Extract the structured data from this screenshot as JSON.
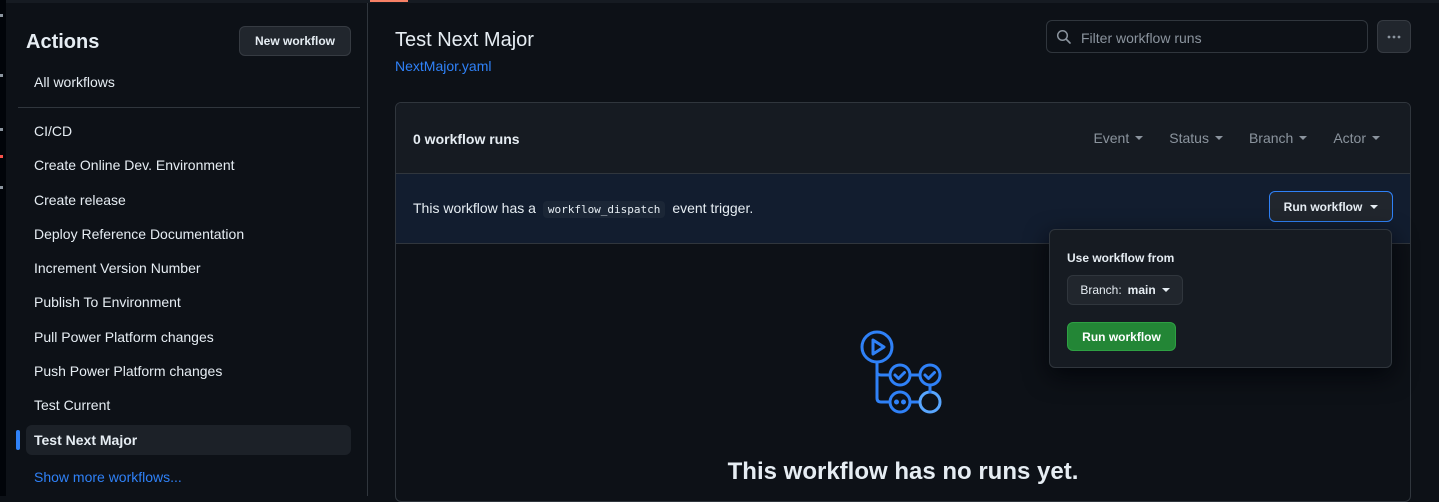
{
  "sidebar": {
    "title": "Actions",
    "new_workflow_label": "New workflow",
    "all_workflows_label": "All workflows",
    "items": [
      {
        "label": "CI/CD"
      },
      {
        "label": "Create Online Dev. Environment"
      },
      {
        "label": "Create release"
      },
      {
        "label": "Deploy Reference Documentation"
      },
      {
        "label": "Increment Version Number"
      },
      {
        "label": "Publish To Environment"
      },
      {
        "label": "Pull Power Platform changes"
      },
      {
        "label": "Push Power Platform changes"
      },
      {
        "label": "Test Current"
      },
      {
        "label": "Test Next Major",
        "active": true
      }
    ],
    "show_more_label": "Show more workflows..."
  },
  "header": {
    "title": "Test Next Major",
    "file": "NextMajor.yaml",
    "filter_placeholder": "Filter workflow runs"
  },
  "runs": {
    "count_label": "0 workflow runs",
    "filters": [
      {
        "label": "Event"
      },
      {
        "label": "Status"
      },
      {
        "label": "Branch"
      },
      {
        "label": "Actor"
      }
    ]
  },
  "trigger": {
    "text_before": "This workflow has a",
    "code": "workflow_dispatch",
    "text_after": "event trigger.",
    "run_button_label": "Run workflow"
  },
  "popover": {
    "title": "Use workflow from",
    "branch_prefix": "Branch:",
    "branch_name": "main",
    "run_button_label": "Run workflow"
  },
  "empty": {
    "title": "This workflow has no runs yet."
  },
  "colors": {
    "background": "#0d1117",
    "accent_blue": "#2f81f7",
    "success_green": "#238636",
    "border": "#30363d"
  }
}
